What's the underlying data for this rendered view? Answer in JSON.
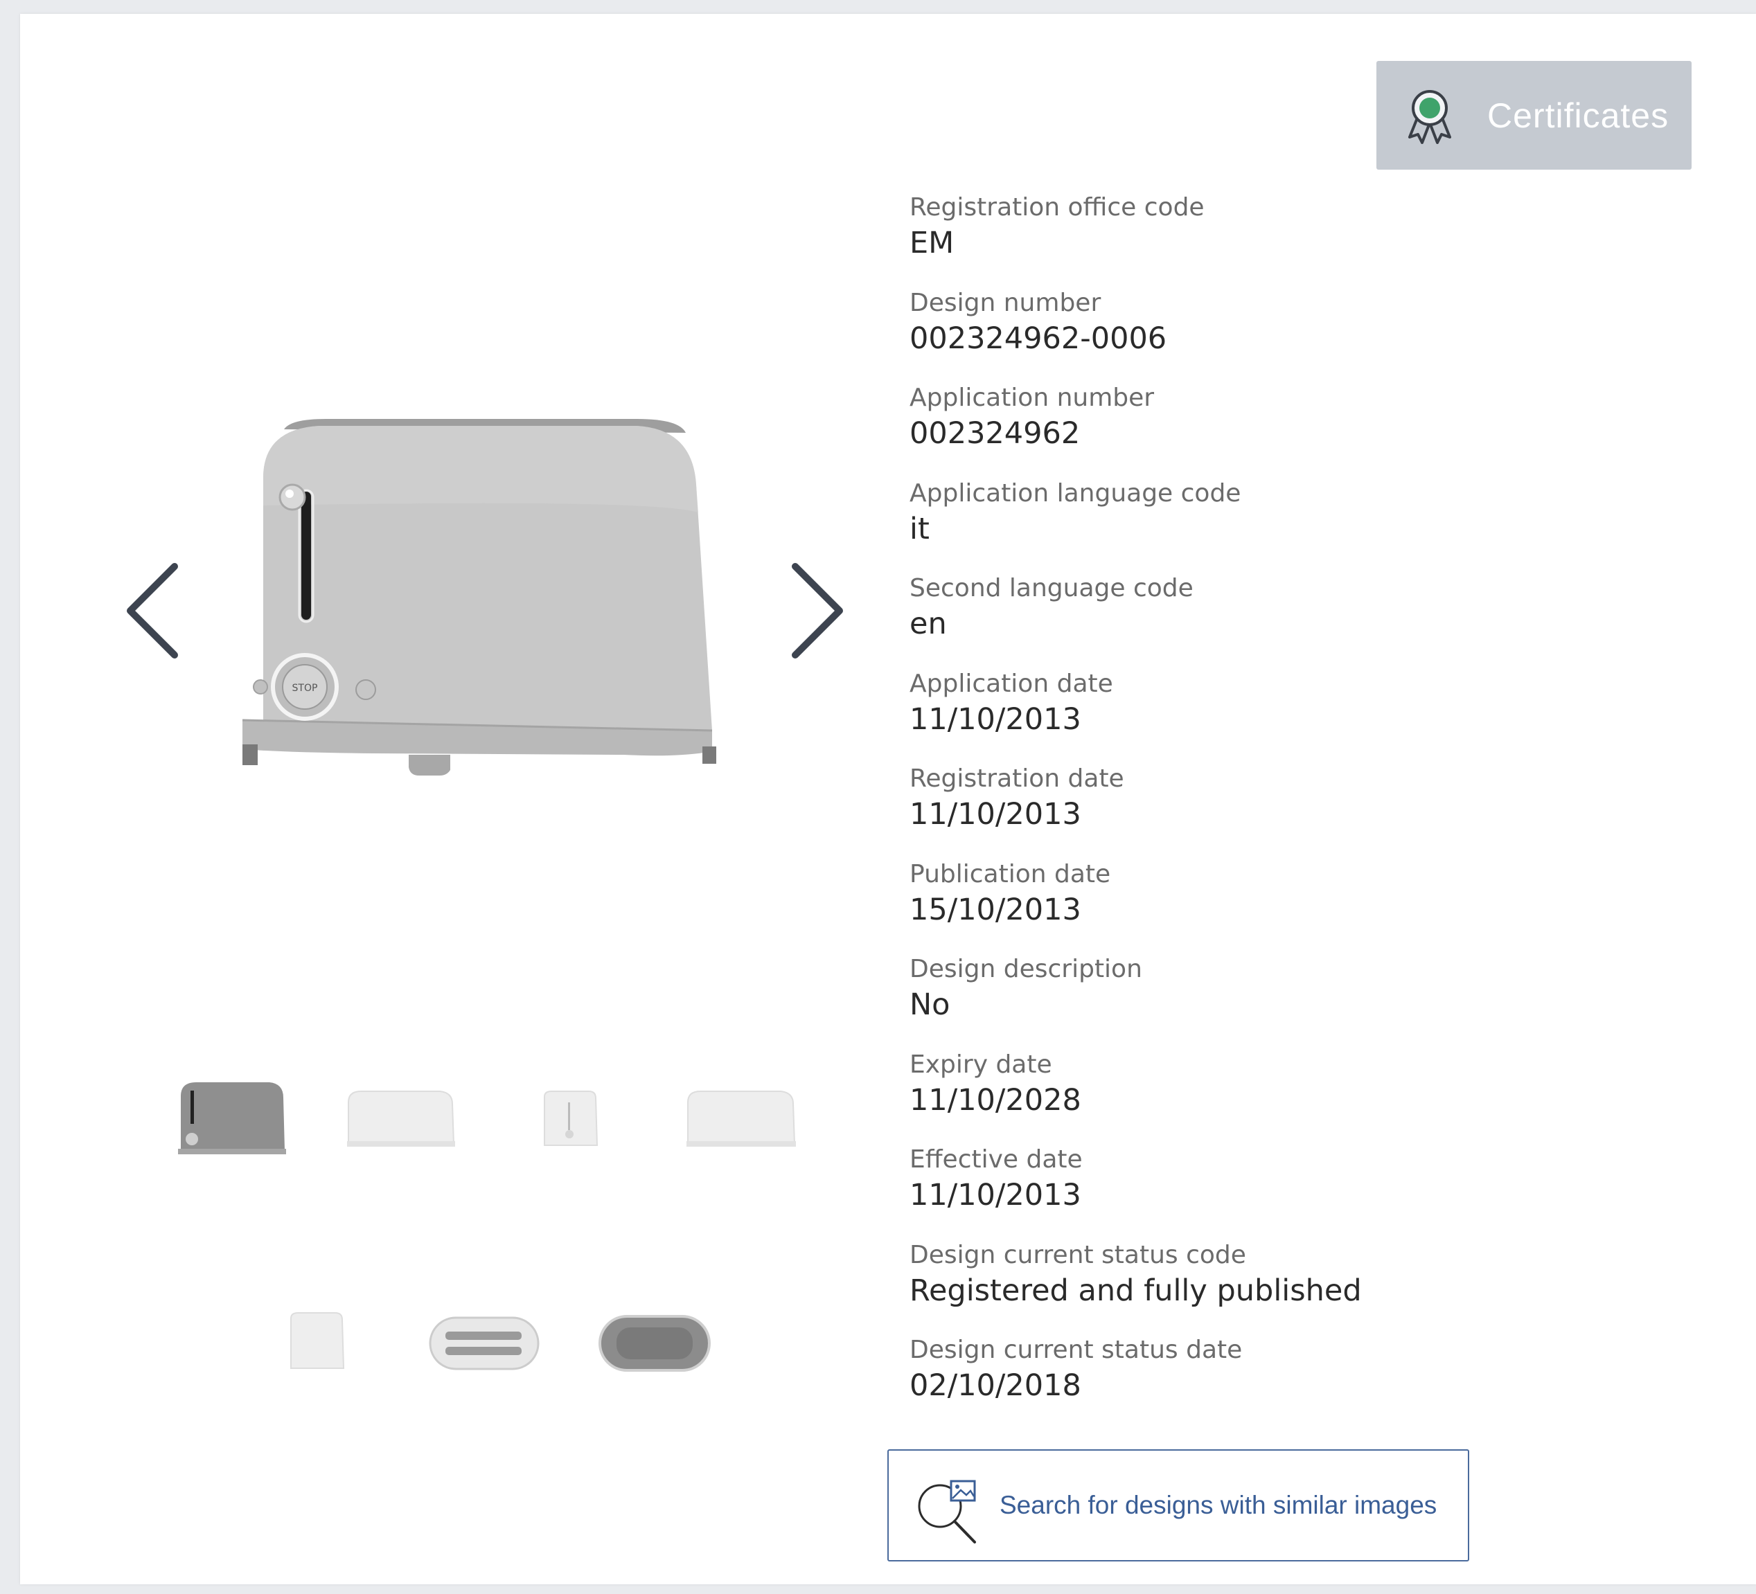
{
  "certificates_button": {
    "label": "Certificates",
    "icon": "award-ribbon-icon"
  },
  "gallery": {
    "prev_icon": "chevron-left-icon",
    "next_icon": "chevron-right-icon",
    "main_image": "toaster-front-view",
    "thumbnails": [
      "toaster-front-view",
      "toaster-side-view-1",
      "toaster-end-view",
      "toaster-side-view-2",
      "toaster-rear-view",
      "toaster-top-view",
      "toaster-bottom-view"
    ]
  },
  "details": [
    {
      "label": "Registration office code",
      "value": "EM"
    },
    {
      "label": "Design number",
      "value": "002324962-0006"
    },
    {
      "label": "Application number",
      "value": "002324962"
    },
    {
      "label": "Application language code",
      "value": "it"
    },
    {
      "label": "Second language code",
      "value": "en"
    },
    {
      "label": "Application date",
      "value": "11/10/2013"
    },
    {
      "label": "Registration date",
      "value": "11/10/2013"
    },
    {
      "label": "Publication date",
      "value": "15/10/2013"
    },
    {
      "label": "Design description",
      "value": "No"
    },
    {
      "label": "Expiry date",
      "value": "11/10/2028"
    },
    {
      "label": "Effective date",
      "value": "11/10/2013"
    },
    {
      "label": "Design current status code",
      "value": "Registered and fully published"
    },
    {
      "label": "Design current status date",
      "value": "02/10/2018"
    }
  ],
  "search_button": {
    "label": "Search for designs with similar images",
    "icon": "image-search-icon"
  },
  "colors": {
    "button_gray": "#c5cad1",
    "link_blue": "#3a5e96",
    "ribbon_green": "#3fa36b"
  }
}
